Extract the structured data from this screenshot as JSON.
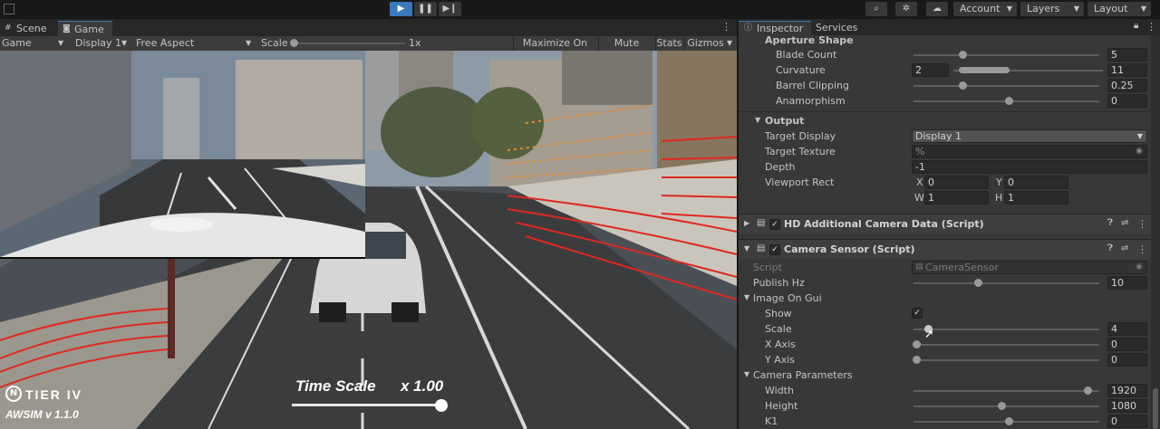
{
  "toolbar": {
    "account": "Account",
    "layers": "Layers",
    "layout": "Layout"
  },
  "tabs": {
    "scene": "Scene",
    "game": "Game"
  },
  "game_bar": {
    "display_mode": "Game",
    "display": "Display 1",
    "aspect": "Free Aspect",
    "scale_label": "Scale",
    "scale_value": "1x",
    "maximize": "Maximize On Play",
    "mute": "Mute Audio",
    "stats": "Stats",
    "gizmos": "Gizmos"
  },
  "overlay": {
    "brand": "TIER IV",
    "version": "AWSIM v 1.1.0",
    "time_scale_label": "Time Scale",
    "time_scale_value": "x 1.00"
  },
  "inspector": {
    "tabs": {
      "inspector": "Inspector",
      "services": "Services"
    },
    "aperture_shape": "Aperture Shape",
    "blade_count": {
      "label": "Blade Count",
      "value": "5"
    },
    "curvature": {
      "label": "Curvature",
      "min": "2",
      "max": "11"
    },
    "barrel_clipping": {
      "label": "Barrel Clipping",
      "value": "0.25"
    },
    "anamorphism": {
      "label": "Anamorphism",
      "value": "0"
    },
    "output": "Output",
    "target_display": {
      "label": "Target Display",
      "value": "Display 1"
    },
    "target_texture": {
      "label": "Target Texture",
      "value": "%"
    },
    "depth": {
      "label": "Depth",
      "value": "-1"
    },
    "viewport_rect": {
      "label": "Viewport Rect",
      "x_lbl": "X",
      "x": "0",
      "y_lbl": "Y",
      "y": "0",
      "w_lbl": "W",
      "w": "1",
      "h_lbl": "H",
      "h": "1"
    },
    "hd_component": "HD Additional Camera Data (Script)",
    "camera_sensor": "Camera Sensor (Script)",
    "script": {
      "label": "Script",
      "value": "CameraSensor"
    },
    "publish_hz": {
      "label": "Publish Hz",
      "value": "10"
    },
    "image_on_gui": "Image On Gui",
    "show": {
      "label": "Show",
      "checked": "✓"
    },
    "scale": {
      "label": "Scale",
      "value": "4"
    },
    "x_axis": {
      "label": "X Axis",
      "value": "0"
    },
    "y_axis": {
      "label": "Y Axis",
      "value": "0"
    },
    "camera_params": "Camera Parameters",
    "width": {
      "label": "Width",
      "value": "1920"
    },
    "height": {
      "label": "Height",
      "value": "1080"
    },
    "k1": {
      "label": "K1",
      "value": "0"
    }
  }
}
